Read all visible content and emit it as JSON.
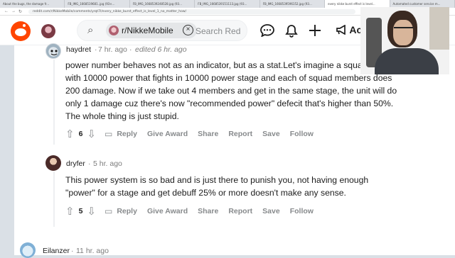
{
  "browser": {
    "tabs": [
      "About the bugs, the damage fr...",
      "FB_IMG_1668519681..jpg (93×...",
      "FB_IMG_1668539248528.jpg (93...",
      "FB_IMG_1668539151113.jpg (93...",
      "FB_IMG_1668539596152.jpg (93...",
      "every nikke burst effect is level...",
      "Automated customer service m..."
    ],
    "active_tab": 5,
    "url": "reddit.com/r/NikkeMobile/comments/yrqt7l/every_nikke_burst_effect_is_level_1_no_matter_how/",
    "nav_icons": [
      "back-icon",
      "forward-icon",
      "reload-icon"
    ]
  },
  "header": {
    "logo": "reddit-logo-icon",
    "search_chip": "r/NikkeMobile",
    "search_placeholder": "Search Red",
    "icons": [
      "chat-icon",
      "bell-icon",
      "plus-icon",
      "megaphone-icon"
    ],
    "ad_label": "Ac"
  },
  "comments": [
    {
      "user": "haydret",
      "time": "7 hr. ago",
      "edited": "edited 6 hr. ago",
      "lines": [
        "power number behaves not as an indicator, but as a stat.Let's imagine a squad of 5",
        "with 10000 power that fights in 10000 power stage and each of squad members does",
        "200 damage. Now if we take out 4 members and get in the same stage, the unit will do",
        "only 1 damage cuz there's now \"recommended power\" defecit that's higher than 50%.",
        "The whole thing is just stupid."
      ],
      "score": "6"
    },
    {
      "user": "dryfer",
      "time": "5 hr. ago",
      "lines": [
        "This power system is so bad and is just there to punish you, not having enough",
        "\"power\" for a stage and get debuff 25% or more doesn't make any sense."
      ],
      "score": "5"
    },
    {
      "user": "Eilanzer",
      "time": "11 hr. ago"
    }
  ],
  "actions": {
    "reply": "Reply",
    "give_award": "Give Award",
    "share": "Share",
    "report": "Report",
    "save": "Save",
    "follow": "Follow"
  },
  "separator": "·",
  "colors": {
    "reddit_orange": "#ff4500",
    "background": "#dae0e6",
    "meta_gray": "#878a8c"
  }
}
